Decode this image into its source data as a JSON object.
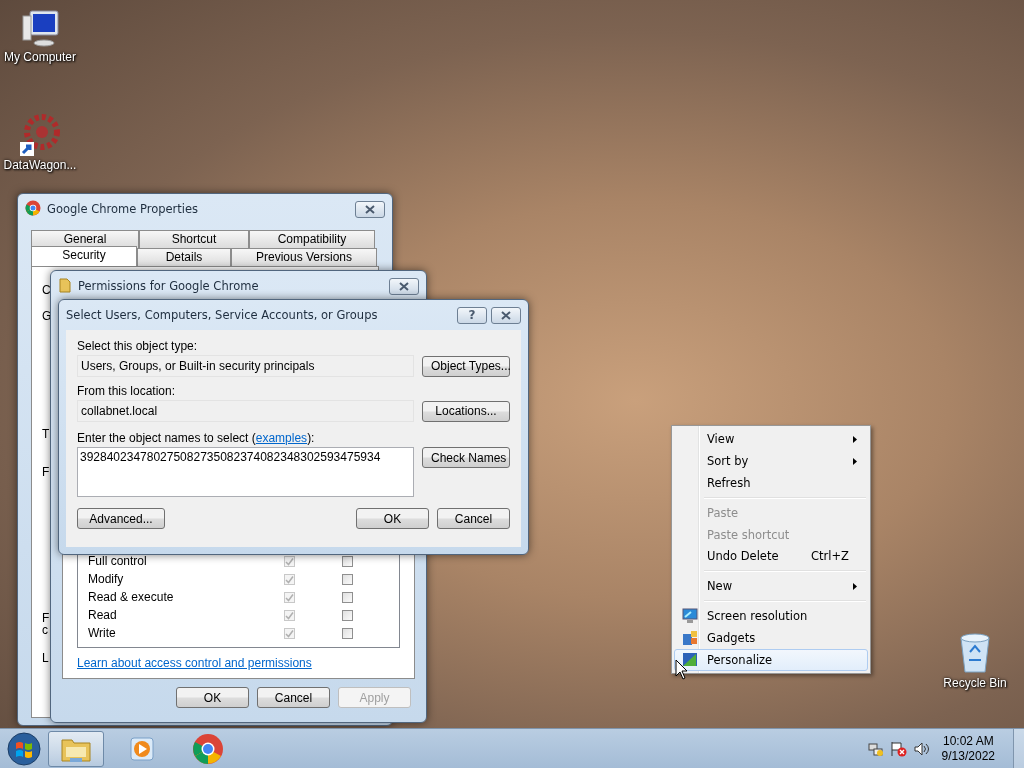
{
  "desktop_icons": [
    {
      "label": "My Computer",
      "kind": "computer"
    },
    {
      "label": "DataWagon...",
      "kind": "shortcut"
    },
    {
      "label": "Recycle Bin",
      "kind": "recycle"
    }
  ],
  "properties_window": {
    "title": "Google Chrome Properties",
    "tab_rows": [
      [
        {
          "label": "General",
          "selected": false
        },
        {
          "label": "Shortcut",
          "selected": false
        },
        {
          "label": "Compatibility",
          "selected": false
        }
      ],
      [
        {
          "label": "Security",
          "selected": true
        },
        {
          "label": "Details",
          "selected": false
        },
        {
          "label": "Previous Versions",
          "selected": false
        }
      ]
    ],
    "cut_texts": [
      "C",
      "G",
      "T",
      "F",
      "F",
      "c",
      "L"
    ]
  },
  "permissions_window": {
    "title": "Permissions for Google Chrome",
    "permissions": [
      {
        "name": "Full control",
        "allow": true,
        "deny": false
      },
      {
        "name": "Modify",
        "allow": true,
        "deny": false
      },
      {
        "name": "Read & execute",
        "allow": true,
        "deny": false
      },
      {
        "name": "Read",
        "allow": true,
        "deny": false
      },
      {
        "name": "Write",
        "allow": true,
        "deny": false
      }
    ],
    "link": "Learn about access control and permissions",
    "buttons": [
      {
        "label": "OK",
        "disabled": false
      },
      {
        "label": "Cancel",
        "disabled": false
      },
      {
        "label": "Apply",
        "disabled": true
      }
    ]
  },
  "select_dialog": {
    "title": "Select Users, Computers, Service Accounts, or Groups",
    "help": "?",
    "object_type_label": "Select this object type:",
    "object_type": "Users, Groups, or Built-in security principals",
    "object_types_button": "Object Types...",
    "location_label": "From this location:",
    "location": "collabnet.local",
    "locations_button": "Locations...",
    "names_label_start": "Enter the object names to select (",
    "names_link": "examples",
    "names_label_end": "):",
    "names_value": "392840234780275082735082374082348302593475934",
    "check_names_button": "Check Names",
    "advanced_button": "Advanced...",
    "ok_button": "OK",
    "cancel_button": "Cancel"
  },
  "context_menu": [
    {
      "kind": "submenu",
      "label": "View",
      "disabled": false,
      "highlighted": false
    },
    {
      "kind": "submenu",
      "label": "Sort by",
      "disabled": false,
      "highlighted": false
    },
    {
      "kind": "item",
      "label": "Refresh",
      "disabled": false,
      "highlighted": false
    },
    {
      "kind": "separator"
    },
    {
      "kind": "item",
      "label": "Paste",
      "disabled": true,
      "highlighted": false
    },
    {
      "kind": "item",
      "label": "Paste shortcut",
      "disabled": true,
      "highlighted": false
    },
    {
      "kind": "item",
      "label": "Undo Delete",
      "shortcut": "Ctrl+Z",
      "disabled": false,
      "highlighted": false
    },
    {
      "kind": "separator"
    },
    {
      "kind": "submenu",
      "label": "New",
      "disabled": false,
      "highlighted": false
    },
    {
      "kind": "separator"
    },
    {
      "kind": "monitor",
      "label": "Screen resolution",
      "disabled": false,
      "highlighted": false
    },
    {
      "kind": "gadgets",
      "label": "Gadgets",
      "disabled": false,
      "highlighted": false
    },
    {
      "kind": "personalize",
      "label": "Personalize",
      "disabled": false,
      "highlighted": true
    }
  ],
  "taskbar": {
    "apps": [
      {
        "kind": "explorer",
        "selected": true
      },
      {
        "kind": "media",
        "selected": false
      },
      {
        "kind": "chrome",
        "selected": false
      }
    ],
    "time": "10:02 AM",
    "date": "9/13/2022"
  }
}
